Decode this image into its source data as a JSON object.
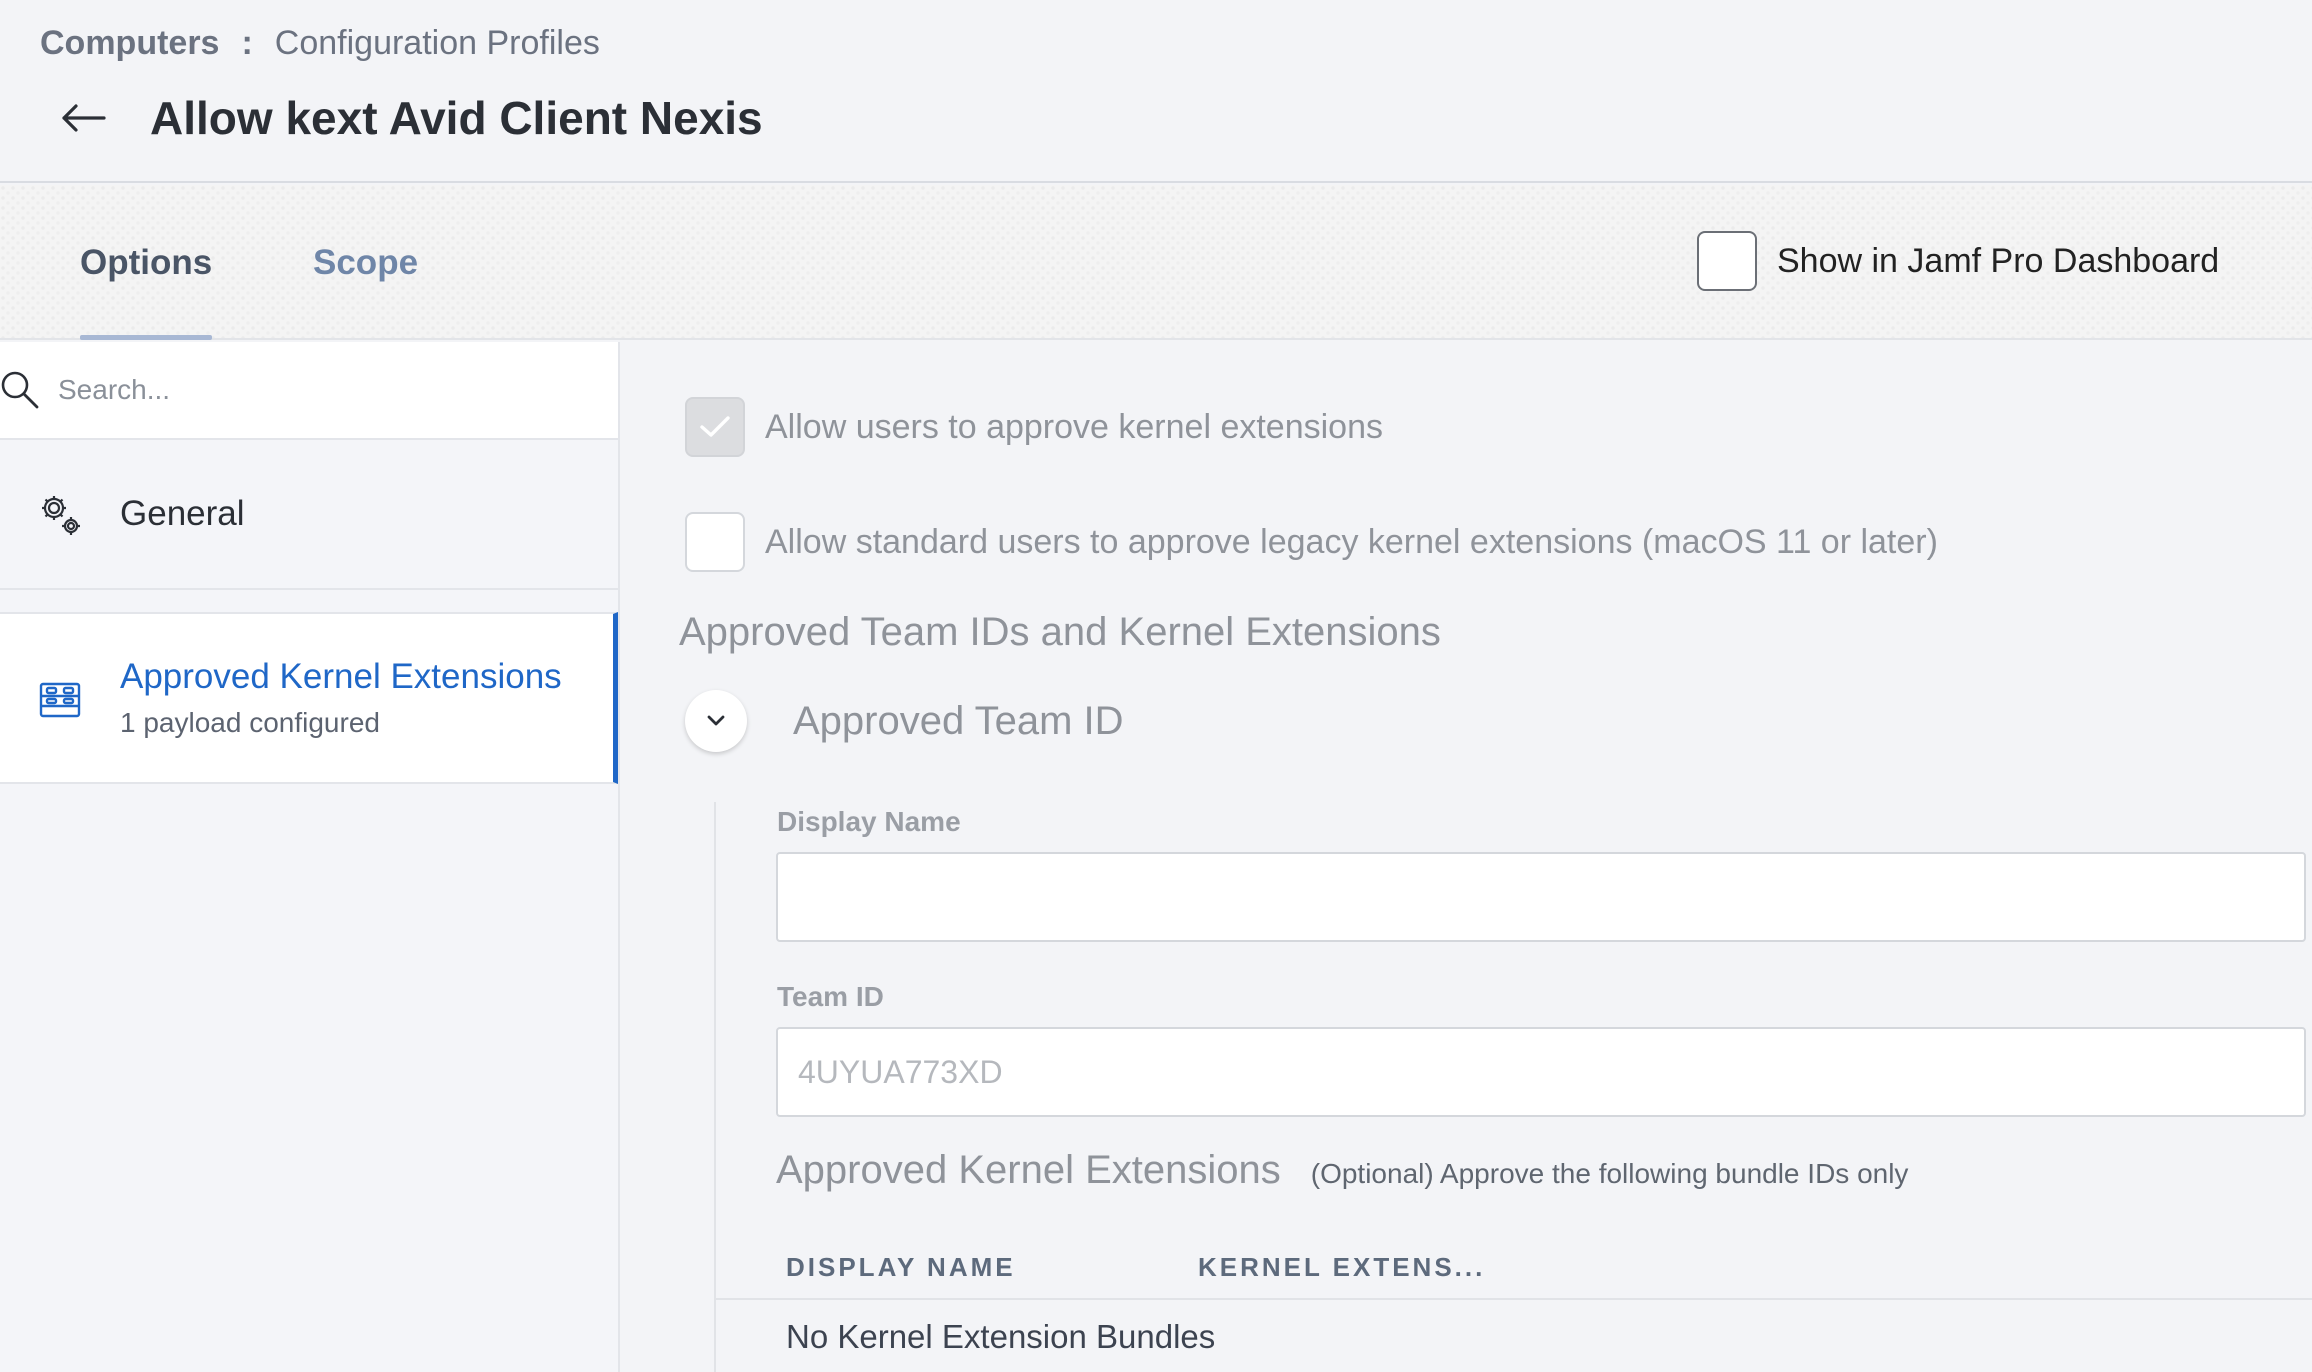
{
  "breadcrumb": {
    "root": "Computers",
    "separator": ":",
    "current": "Configuration Profiles"
  },
  "page": {
    "title": "Allow kext Avid Client Nexis"
  },
  "tabs": {
    "options": "Options",
    "scope": "Scope",
    "active": "Options"
  },
  "dashboard": {
    "label": "Show in Jamf Pro Dashboard",
    "checked": false
  },
  "sidebar": {
    "search_placeholder": "Search...",
    "items": [
      {
        "label": "General",
        "icon": "gears-icon"
      },
      {
        "label": "Approved Kernel Extensions",
        "sub": "1 payload configured",
        "icon": "kernel-extension-icon",
        "selected": true
      }
    ]
  },
  "options": {
    "allow_users_label": "Allow users to approve kernel extensions",
    "allow_users_checked": true,
    "allow_standard_label": "Allow standard users to approve legacy kernel extensions (macOS 11 or later)",
    "allow_standard_checked": false
  },
  "section": {
    "heading": "Approved Team IDs and Kernel Extensions",
    "team_heading": "Approved Team ID",
    "display_name_label": "Display Name",
    "display_name_value": "",
    "team_id_label": "Team ID",
    "team_id_placeholder": "4UYUA773XD",
    "ake_heading": "Approved Kernel Extensions",
    "ake_note": "(Optional) Approve the following bundle IDs only",
    "table_headers": [
      "DISPLAY NAME",
      "KERNEL EXTENS..."
    ],
    "empty_text": "No Kernel Extension Bundles"
  },
  "colors": {
    "accent": "#1f67c7",
    "muted_text": "#8f939a",
    "tab_underline": "#a8b8d4"
  }
}
